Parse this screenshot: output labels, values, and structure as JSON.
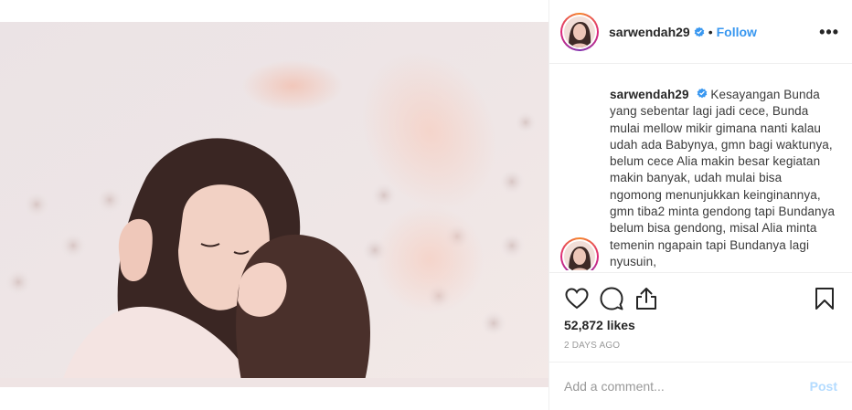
{
  "post": {
    "username": "sarwendah29",
    "follow_label": "Follow",
    "separator": "•",
    "more_label": "•••",
    "verified": true,
    "photo_alt_icon": "post-photo"
  },
  "caption": {
    "username": "sarwendah29",
    "text": "Kesayangan Bunda yang sebentar lagi jadi cece, Bunda mulai mellow mikir gimana nanti kalau udah ada Babynya, gmn bagi waktunya, belum cece Alia makin besar kegiatan makin banyak, udah mulai bisa ngomong menunjukkan keinginannya, gmn tiba2 minta gendong tapi Bundanya belum bisa gendong, misal Alia minta temenin ngapain tapi Bundanya lagi nyusuin,"
  },
  "actions": {
    "like_icon": "heart-icon",
    "comment_icon": "comment-icon",
    "share_icon": "share-icon",
    "save_icon": "bookmark-icon"
  },
  "likes": "52,872 likes",
  "timestamp": "2 DAYS AGO",
  "add_comment": {
    "placeholder": "Add a comment...",
    "post_label": "Post"
  },
  "colors": {
    "follow": "#3897f0",
    "post_disabled": "#b3dbff",
    "verified": "#3897f0",
    "muted": "#999999",
    "border": "#efefef"
  }
}
